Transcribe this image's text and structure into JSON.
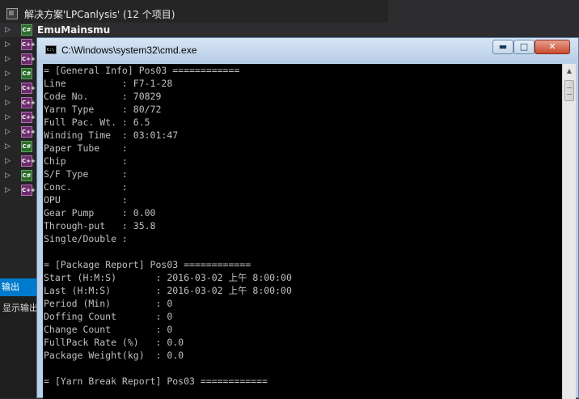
{
  "solution": {
    "title": "解决方案'LPCanlysis' (12 个项目)",
    "first_project": "EmuMainsmu",
    "projects": [
      {
        "type": "C#"
      },
      {
        "type": "C++"
      },
      {
        "type": "C++"
      },
      {
        "type": "C#"
      },
      {
        "type": "C++"
      },
      {
        "type": "C++"
      },
      {
        "type": "C++"
      },
      {
        "type": "C++"
      },
      {
        "type": "C#"
      },
      {
        "type": "C++"
      },
      {
        "type": "C#"
      },
      {
        "type": "C++"
      }
    ]
  },
  "output_panel": {
    "tab_label": "输出",
    "show_label": "显示输出"
  },
  "cmd": {
    "title": "C:\\Windows\\system32\\cmd.exe",
    "buttons": {
      "min": "▬",
      "max": "□",
      "close": "✕"
    },
    "lines": [
      "= [General Info] Pos03 ============",
      "Line          : F7-1-28",
      "Code No.      : 70829",
      "Yarn Type     : 80/72",
      "Full Pac. Wt. : 6.5",
      "Winding Time  : 03:01:47",
      "Paper Tube    :",
      "Chip          :",
      "S/F Type      :",
      "Conc.         :",
      "OPU           :",
      "Gear Pump     : 0.00",
      "Through-put   : 35.8",
      "Single/Double :",
      "",
      "= [Package Report] Pos03 ============",
      "Start (H:M:S)       : 2016-03-02 上午 8:00:00",
      "Last (H:M:S)        : 2016-03-02 上午 8:00:00",
      "Period (Min)        : 0",
      "Doffing Count       : 0",
      "Change Count        : 0",
      "FullPack Rate (%)   : 0.0",
      "Package Weight(kg)  : 0.0",
      "",
      "= [Yarn Break Report] Pos03 ============"
    ]
  }
}
